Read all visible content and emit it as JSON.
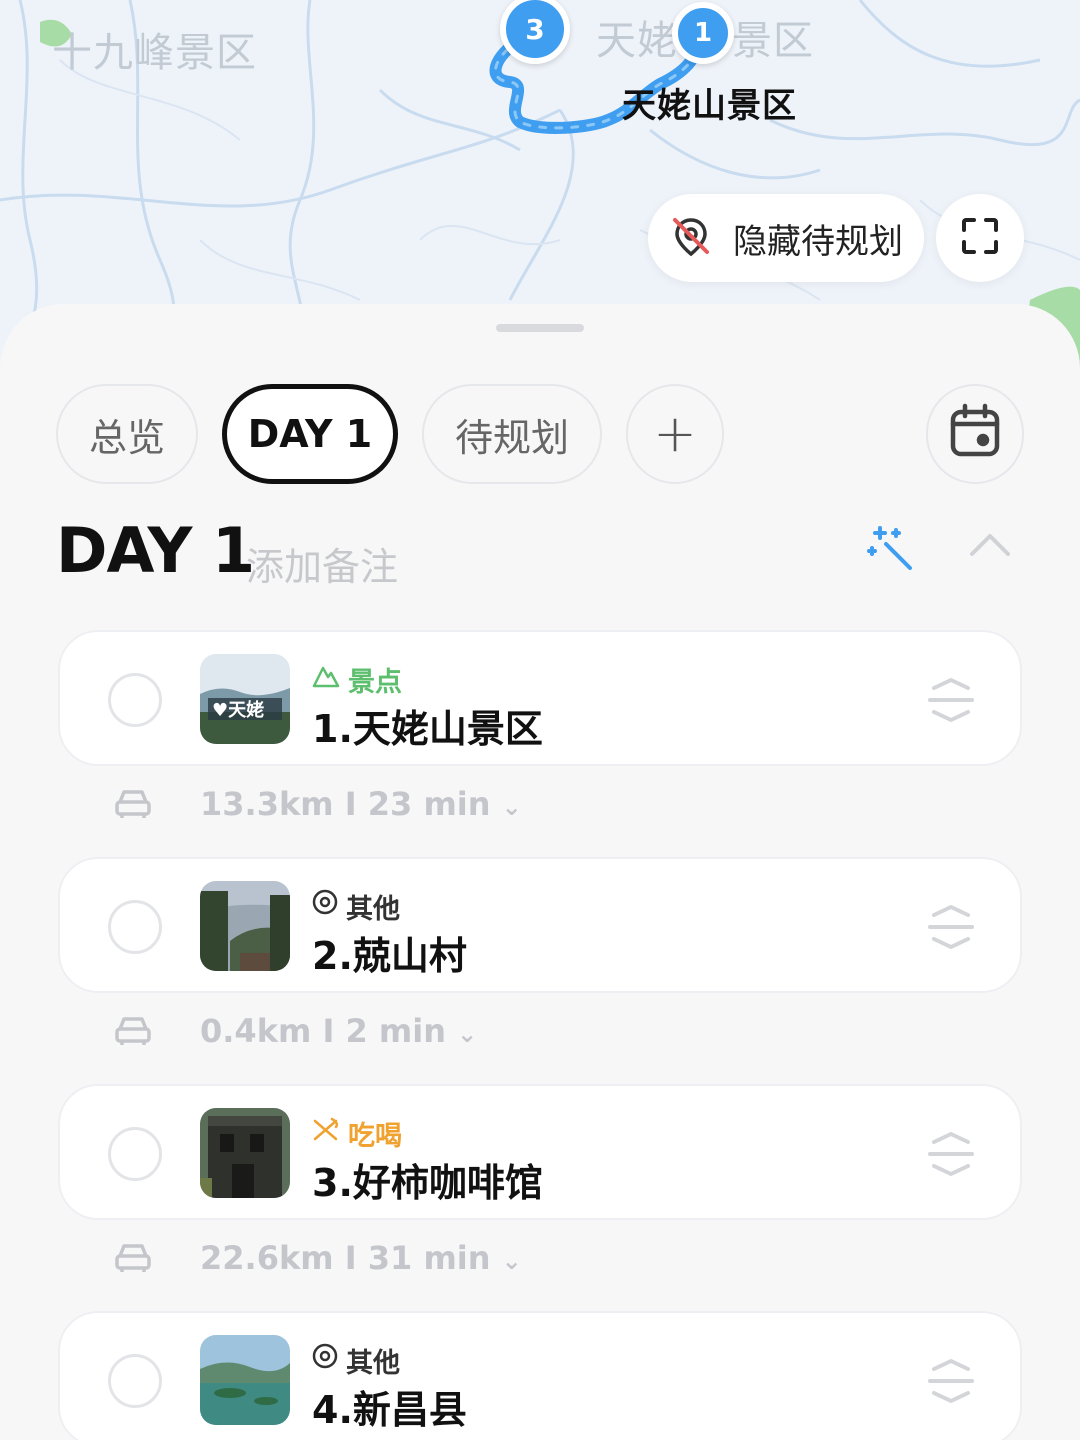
{
  "map": {
    "labels": {
      "region_1": "十九峰景区",
      "region_2_left": "天姥",
      "region_2_right": "景区",
      "poi": "天姥山景区"
    },
    "pins": [
      {
        "number": "3"
      },
      {
        "number": "1"
      }
    ],
    "hide_button_label": "隐藏待规划",
    "route_color": "#3f9ef0"
  },
  "tabs": {
    "overview": "总览",
    "day1": "DAY 1",
    "pending": "待规划",
    "add": "+"
  },
  "day": {
    "title": "DAY 1",
    "note_placeholder": "添加备注"
  },
  "places": [
    {
      "category": "景点",
      "category_icon": "mountain-icon",
      "name": "1.天姥山景区"
    },
    {
      "category": "其他",
      "category_icon": "location-pin-icon",
      "name": "2.兢山村"
    },
    {
      "category": "吃喝",
      "category_icon": "utensils-icon",
      "name": "3.好柿咖啡馆"
    },
    {
      "category": "其他",
      "category_icon": "location-pin-icon",
      "name": "4.新昌县"
    }
  ],
  "routes": [
    {
      "text": "13.3km  I  23 min"
    },
    {
      "text": "0.4km  I  2 min"
    },
    {
      "text": "22.6km  I  31 min"
    }
  ],
  "colors": {
    "accent_blue": "#3f9ef0",
    "scenic_green": "#5dbf6d",
    "food_orange": "#f0a231"
  }
}
